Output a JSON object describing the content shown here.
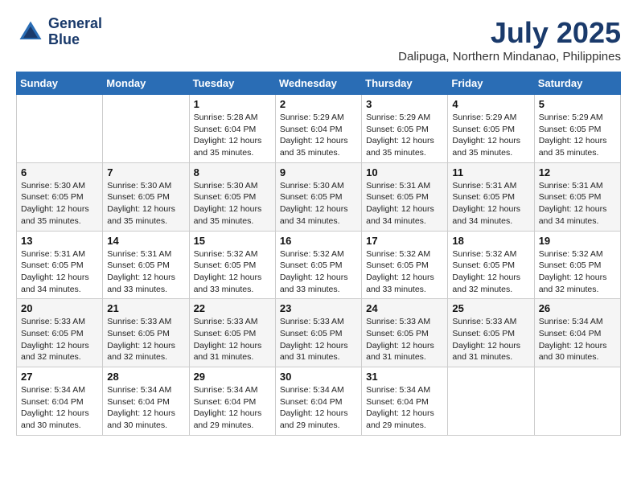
{
  "header": {
    "logo_line1": "General",
    "logo_line2": "Blue",
    "month": "July 2025",
    "location": "Dalipuga, Northern Mindanao, Philippines"
  },
  "weekdays": [
    "Sunday",
    "Monday",
    "Tuesday",
    "Wednesday",
    "Thursday",
    "Friday",
    "Saturday"
  ],
  "weeks": [
    [
      {
        "day": "",
        "sunrise": "",
        "sunset": "",
        "daylight": ""
      },
      {
        "day": "",
        "sunrise": "",
        "sunset": "",
        "daylight": ""
      },
      {
        "day": "1",
        "sunrise": "Sunrise: 5:28 AM",
        "sunset": "Sunset: 6:04 PM",
        "daylight": "Daylight: 12 hours and 35 minutes."
      },
      {
        "day": "2",
        "sunrise": "Sunrise: 5:29 AM",
        "sunset": "Sunset: 6:04 PM",
        "daylight": "Daylight: 12 hours and 35 minutes."
      },
      {
        "day": "3",
        "sunrise": "Sunrise: 5:29 AM",
        "sunset": "Sunset: 6:05 PM",
        "daylight": "Daylight: 12 hours and 35 minutes."
      },
      {
        "day": "4",
        "sunrise": "Sunrise: 5:29 AM",
        "sunset": "Sunset: 6:05 PM",
        "daylight": "Daylight: 12 hours and 35 minutes."
      },
      {
        "day": "5",
        "sunrise": "Sunrise: 5:29 AM",
        "sunset": "Sunset: 6:05 PM",
        "daylight": "Daylight: 12 hours and 35 minutes."
      }
    ],
    [
      {
        "day": "6",
        "sunrise": "Sunrise: 5:30 AM",
        "sunset": "Sunset: 6:05 PM",
        "daylight": "Daylight: 12 hours and 35 minutes."
      },
      {
        "day": "7",
        "sunrise": "Sunrise: 5:30 AM",
        "sunset": "Sunset: 6:05 PM",
        "daylight": "Daylight: 12 hours and 35 minutes."
      },
      {
        "day": "8",
        "sunrise": "Sunrise: 5:30 AM",
        "sunset": "Sunset: 6:05 PM",
        "daylight": "Daylight: 12 hours and 35 minutes."
      },
      {
        "day": "9",
        "sunrise": "Sunrise: 5:30 AM",
        "sunset": "Sunset: 6:05 PM",
        "daylight": "Daylight: 12 hours and 34 minutes."
      },
      {
        "day": "10",
        "sunrise": "Sunrise: 5:31 AM",
        "sunset": "Sunset: 6:05 PM",
        "daylight": "Daylight: 12 hours and 34 minutes."
      },
      {
        "day": "11",
        "sunrise": "Sunrise: 5:31 AM",
        "sunset": "Sunset: 6:05 PM",
        "daylight": "Daylight: 12 hours and 34 minutes."
      },
      {
        "day": "12",
        "sunrise": "Sunrise: 5:31 AM",
        "sunset": "Sunset: 6:05 PM",
        "daylight": "Daylight: 12 hours and 34 minutes."
      }
    ],
    [
      {
        "day": "13",
        "sunrise": "Sunrise: 5:31 AM",
        "sunset": "Sunset: 6:05 PM",
        "daylight": "Daylight: 12 hours and 34 minutes."
      },
      {
        "day": "14",
        "sunrise": "Sunrise: 5:31 AM",
        "sunset": "Sunset: 6:05 PM",
        "daylight": "Daylight: 12 hours and 33 minutes."
      },
      {
        "day": "15",
        "sunrise": "Sunrise: 5:32 AM",
        "sunset": "Sunset: 6:05 PM",
        "daylight": "Daylight: 12 hours and 33 minutes."
      },
      {
        "day": "16",
        "sunrise": "Sunrise: 5:32 AM",
        "sunset": "Sunset: 6:05 PM",
        "daylight": "Daylight: 12 hours and 33 minutes."
      },
      {
        "day": "17",
        "sunrise": "Sunrise: 5:32 AM",
        "sunset": "Sunset: 6:05 PM",
        "daylight": "Daylight: 12 hours and 33 minutes."
      },
      {
        "day": "18",
        "sunrise": "Sunrise: 5:32 AM",
        "sunset": "Sunset: 6:05 PM",
        "daylight": "Daylight: 12 hours and 32 minutes."
      },
      {
        "day": "19",
        "sunrise": "Sunrise: 5:32 AM",
        "sunset": "Sunset: 6:05 PM",
        "daylight": "Daylight: 12 hours and 32 minutes."
      }
    ],
    [
      {
        "day": "20",
        "sunrise": "Sunrise: 5:33 AM",
        "sunset": "Sunset: 6:05 PM",
        "daylight": "Daylight: 12 hours and 32 minutes."
      },
      {
        "day": "21",
        "sunrise": "Sunrise: 5:33 AM",
        "sunset": "Sunset: 6:05 PM",
        "daylight": "Daylight: 12 hours and 32 minutes."
      },
      {
        "day": "22",
        "sunrise": "Sunrise: 5:33 AM",
        "sunset": "Sunset: 6:05 PM",
        "daylight": "Daylight: 12 hours and 31 minutes."
      },
      {
        "day": "23",
        "sunrise": "Sunrise: 5:33 AM",
        "sunset": "Sunset: 6:05 PM",
        "daylight": "Daylight: 12 hours and 31 minutes."
      },
      {
        "day": "24",
        "sunrise": "Sunrise: 5:33 AM",
        "sunset": "Sunset: 6:05 PM",
        "daylight": "Daylight: 12 hours and 31 minutes."
      },
      {
        "day": "25",
        "sunrise": "Sunrise: 5:33 AM",
        "sunset": "Sunset: 6:05 PM",
        "daylight": "Daylight: 12 hours and 31 minutes."
      },
      {
        "day": "26",
        "sunrise": "Sunrise: 5:34 AM",
        "sunset": "Sunset: 6:04 PM",
        "daylight": "Daylight: 12 hours and 30 minutes."
      }
    ],
    [
      {
        "day": "27",
        "sunrise": "Sunrise: 5:34 AM",
        "sunset": "Sunset: 6:04 PM",
        "daylight": "Daylight: 12 hours and 30 minutes."
      },
      {
        "day": "28",
        "sunrise": "Sunrise: 5:34 AM",
        "sunset": "Sunset: 6:04 PM",
        "daylight": "Daylight: 12 hours and 30 minutes."
      },
      {
        "day": "29",
        "sunrise": "Sunrise: 5:34 AM",
        "sunset": "Sunset: 6:04 PM",
        "daylight": "Daylight: 12 hours and 29 minutes."
      },
      {
        "day": "30",
        "sunrise": "Sunrise: 5:34 AM",
        "sunset": "Sunset: 6:04 PM",
        "daylight": "Daylight: 12 hours and 29 minutes."
      },
      {
        "day": "31",
        "sunrise": "Sunrise: 5:34 AM",
        "sunset": "Sunset: 6:04 PM",
        "daylight": "Daylight: 12 hours and 29 minutes."
      },
      {
        "day": "",
        "sunrise": "",
        "sunset": "",
        "daylight": ""
      },
      {
        "day": "",
        "sunrise": "",
        "sunset": "",
        "daylight": ""
      }
    ]
  ]
}
